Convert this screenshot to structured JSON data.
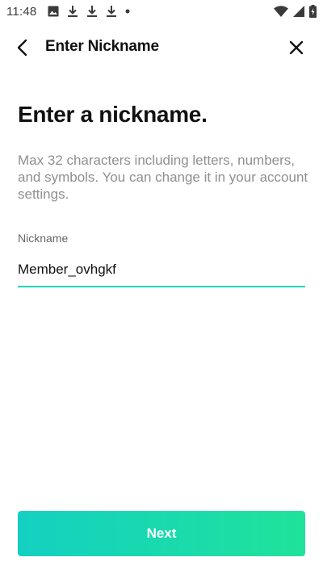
{
  "status_bar": {
    "time": "11:48",
    "icons_left": [
      "image-icon",
      "download-icon",
      "download-icon",
      "download-icon",
      "dot-icon"
    ],
    "icons_right": [
      "wifi-icon",
      "cell-signal-icon",
      "battery-charging-icon"
    ]
  },
  "app_bar": {
    "title": "Enter Nickname",
    "back_icon": "chevron-left-icon",
    "close_icon": "close-icon"
  },
  "content": {
    "heading": "Enter a nickname.",
    "description": "Max 32 characters including letters, numbers, and symbols. You can change it in your account settings.",
    "field_label": "Nickname",
    "nickname_value": "Member_ovhgkf"
  },
  "footer": {
    "next_label": "Next"
  },
  "colors": {
    "accent": "#1ed7b4",
    "button_gradient_start": "#14d0c2",
    "button_gradient_end": "#1fe39a",
    "description_text": "#8f8f8f"
  }
}
